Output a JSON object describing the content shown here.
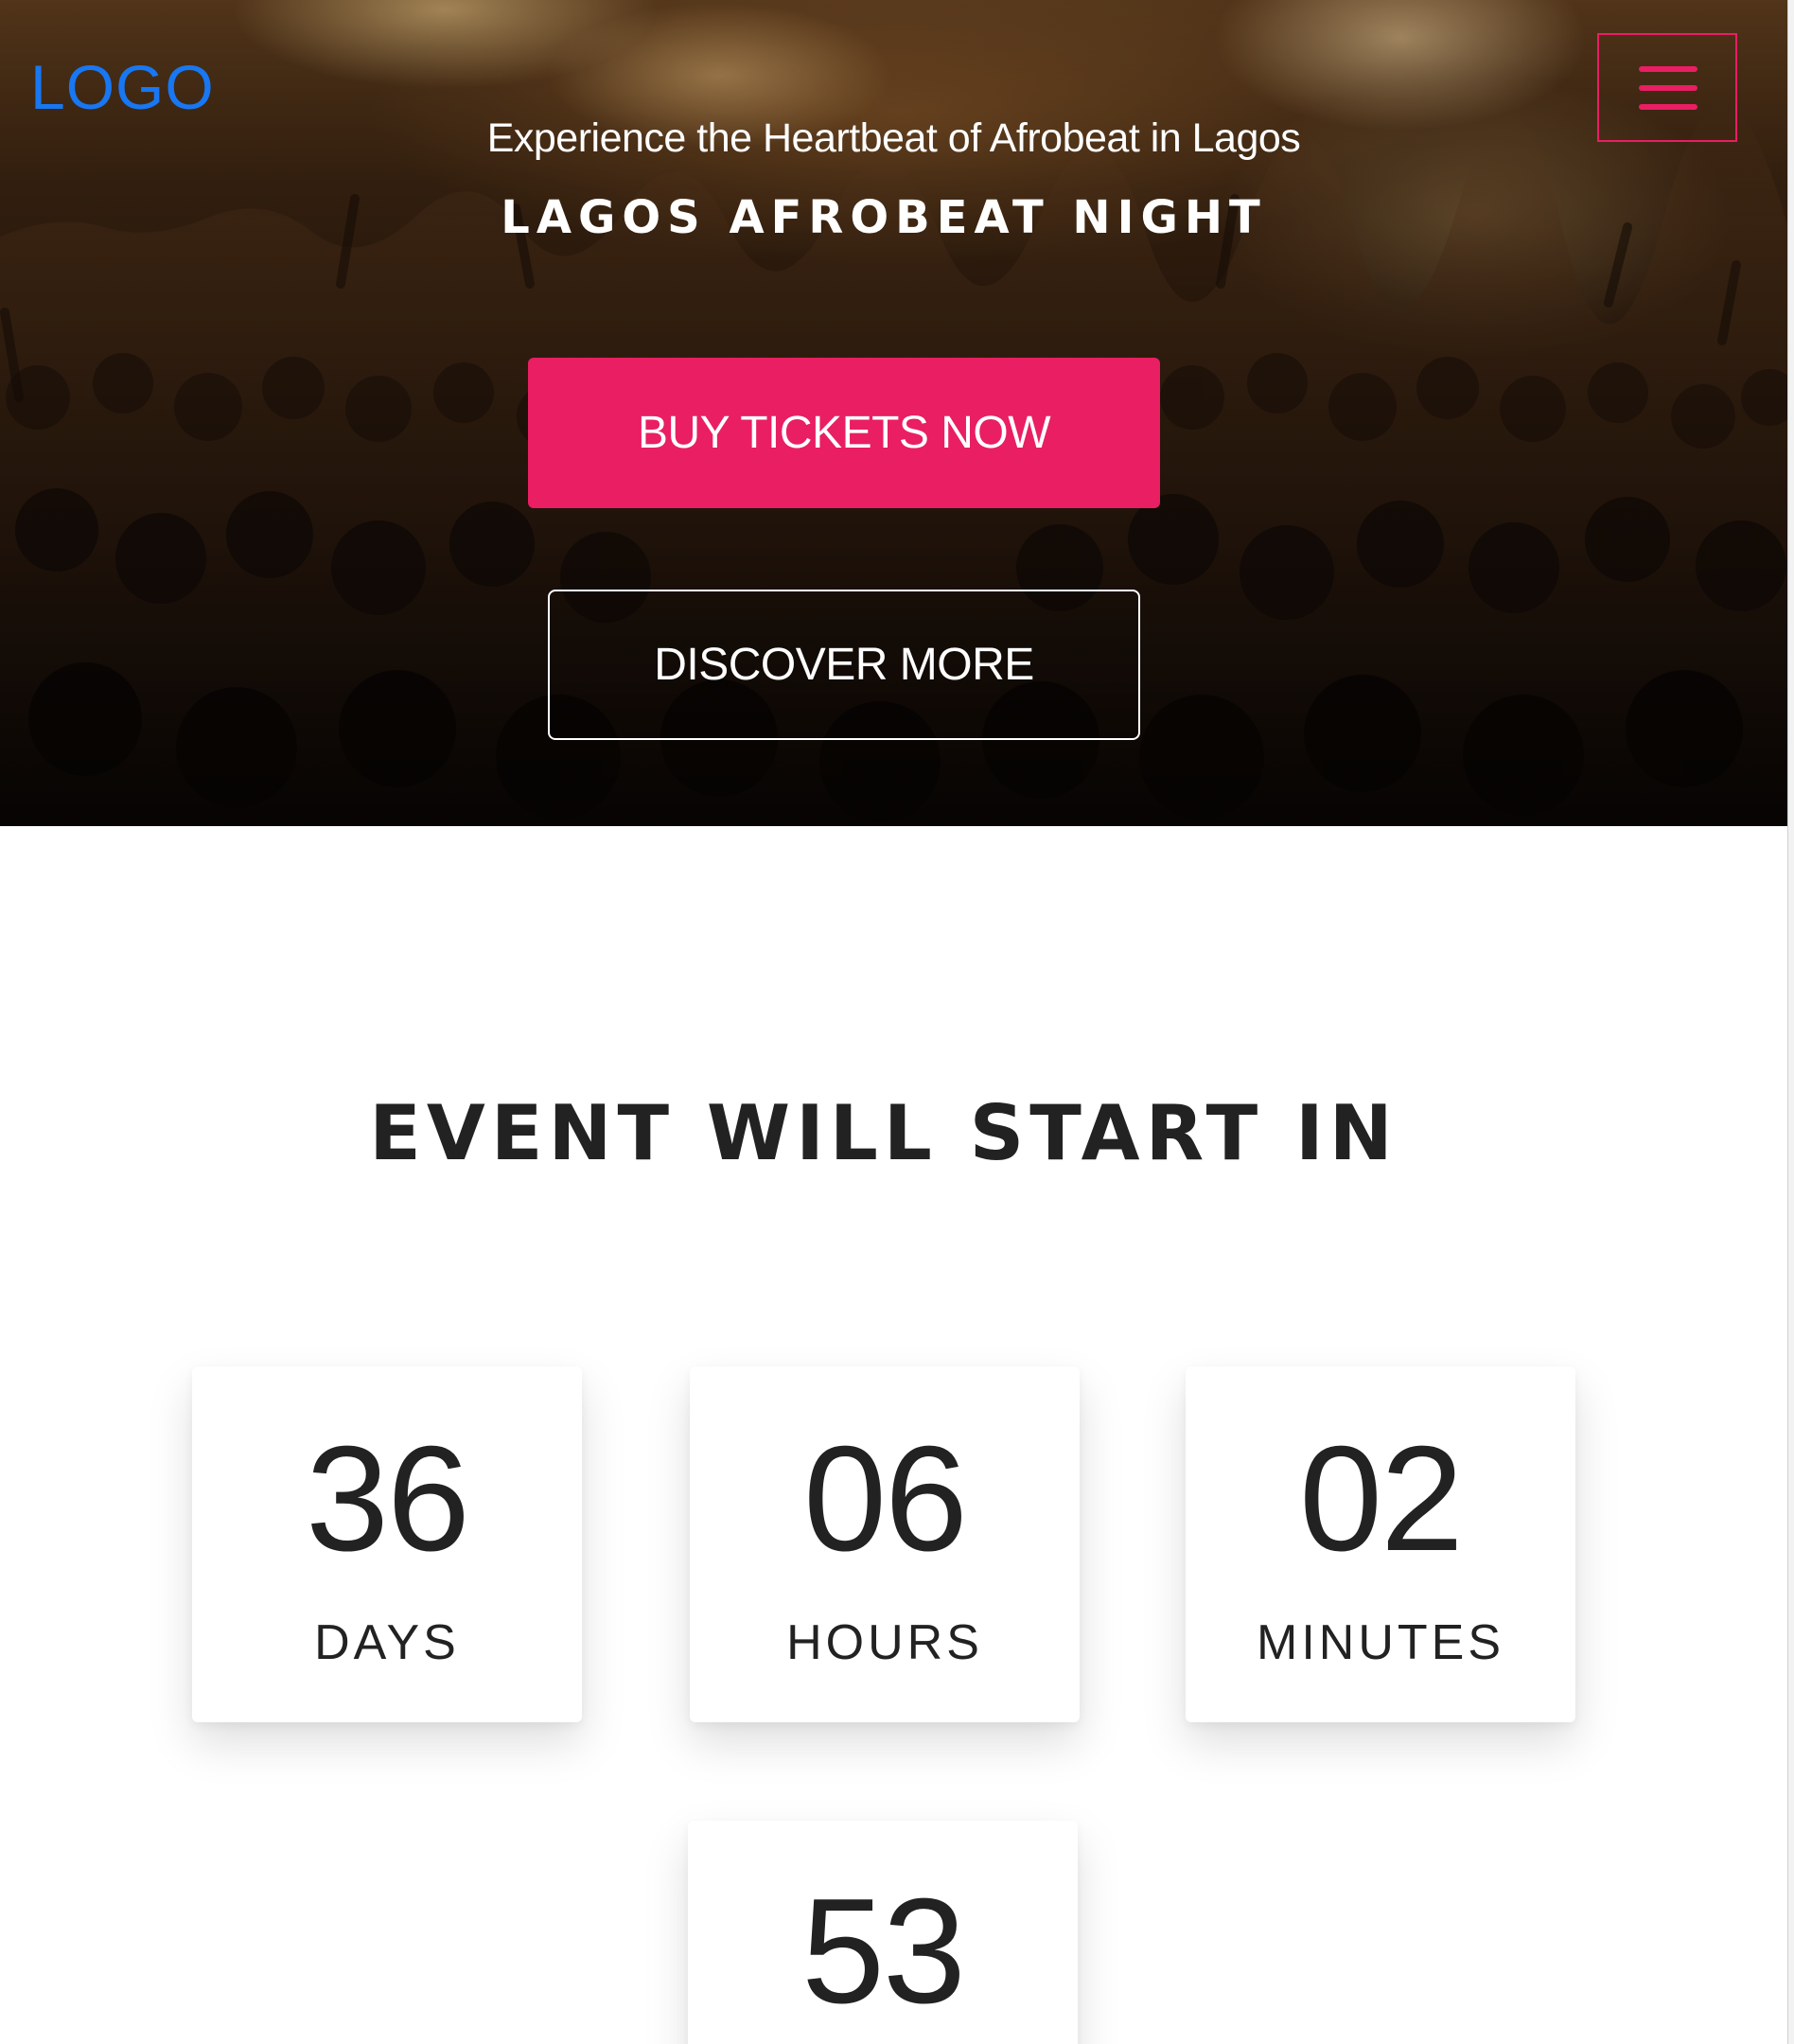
{
  "header": {
    "logo": "LOGO",
    "menu_icon": "hamburger-icon"
  },
  "hero": {
    "tagline": "Experience the Heartbeat of Afrobeat in Lagos",
    "title": "LAGOS AFROBEAT NIGHT",
    "buy_label": "BUY TICKETS NOW",
    "discover_label": "DISCOVER MORE"
  },
  "countdown": {
    "heading": "EVENT WILL START IN",
    "days": {
      "value": "36",
      "label": "DAYS"
    },
    "hours": {
      "value": "06",
      "label": "HOURS"
    },
    "minutes": {
      "value": "02",
      "label": "MINUTES"
    },
    "seconds": {
      "value": "53"
    }
  },
  "colors": {
    "accent": "#e91e63",
    "logo": "#1877f2",
    "text_dark": "#222222"
  }
}
